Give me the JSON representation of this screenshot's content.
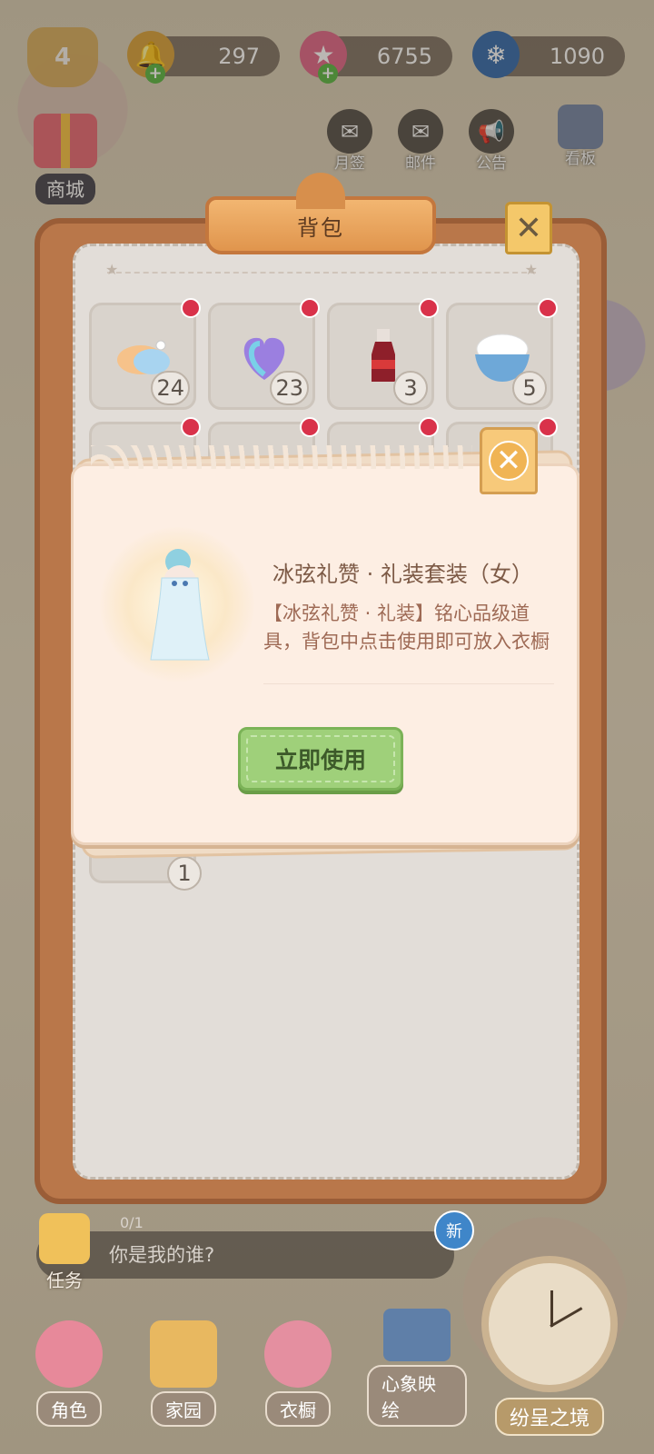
{
  "top_bar": {
    "level": "4",
    "resources": [
      {
        "name": "bell-icon",
        "value": "297"
      },
      {
        "name": "star-gem-icon",
        "value": "6755"
      },
      {
        "name": "snowflake-icon",
        "value": "1090"
      }
    ]
  },
  "shortcuts": {
    "shop": "商城",
    "month_sign": "月签",
    "mail": "邮件",
    "notice": "公告",
    "board": "看板"
  },
  "backpack": {
    "title": "背包",
    "items": [
      {
        "icon": "soap-bar-icon",
        "count": "24"
      },
      {
        "icon": "heart-fan-icon",
        "count": "23"
      },
      {
        "icon": "cola-bottle-icon",
        "count": "3"
      },
      {
        "icon": "rice-bowl-icon",
        "count": "5"
      }
    ],
    "partial_count": "1"
  },
  "popup": {
    "item_name": "冰弦礼赞 · 礼装套装（女）",
    "item_description": "【冰弦礼赞 · 礼装】铭心品级道具，背包中点击使用即可放入衣橱",
    "use_button": "立即使用"
  },
  "task": {
    "label": "任务",
    "progress": "0/1",
    "text": "你是我的谁?",
    "new_badge": "新"
  },
  "bottom_nav": {
    "role": "角色",
    "home": "家园",
    "wardrobe": "衣橱",
    "cards": "心象映绘",
    "realm": "纷呈之境"
  },
  "colors": {
    "panel_brown": "#b9774a",
    "use_button_green": "#9fd07a",
    "notification_red": "#d9324a",
    "popup_bg": "#fdeee3"
  }
}
